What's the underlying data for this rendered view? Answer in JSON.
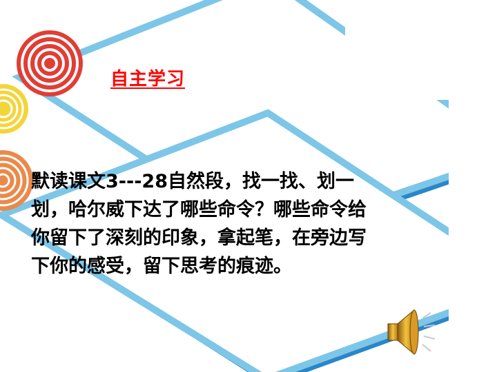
{
  "slide": {
    "title": "自主学习",
    "body_lines": [
      "默读课文3---28自然段，找一找、划一",
      "划，哈尔威下达了哪些命令？哪些命令给",
      "你留下了深刻的印象，拿起笔，在旁边写",
      "下你的感受，留下思考的痕迹。"
    ]
  },
  "icons": {
    "speaker": "speaker-icon",
    "swirl": "spiral-icon"
  },
  "colors": {
    "title": "#ff0000",
    "text": "#000000",
    "diamond_fill": "#ffffff",
    "diamond_border": "#7dc6e8",
    "diamond_shadow": "#2a86c8",
    "spiral_red": "#e03e35",
    "spiral_yellow": "#f3d53a",
    "spiral_orange": "#e98a4c"
  }
}
